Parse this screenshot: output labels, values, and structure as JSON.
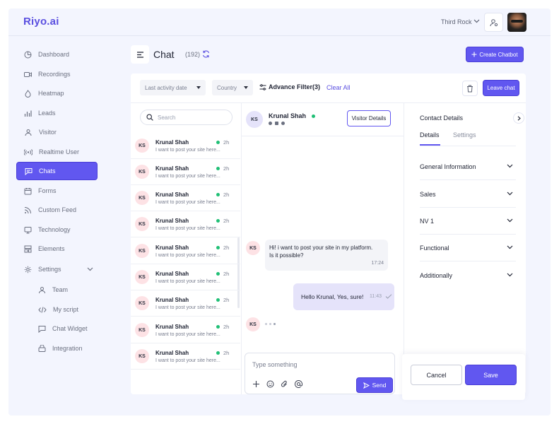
{
  "brand": {
    "logo": "Riyo.ai",
    "accent": "#6157f0"
  },
  "header": {
    "org": "Third Rock"
  },
  "sidebar": {
    "items": [
      {
        "label": "Dashboard",
        "icon": "dashboard-icon"
      },
      {
        "label": "Recordings",
        "icon": "video-icon"
      },
      {
        "label": "Heatmap",
        "icon": "heatmap-icon"
      },
      {
        "label": "Leads",
        "icon": "bar-chart-icon"
      },
      {
        "label": "Visitor",
        "icon": "users-icon"
      },
      {
        "label": "Realtime User",
        "icon": "broadcast-icon"
      },
      {
        "label": "Chats",
        "icon": "chat-icon",
        "active": true
      },
      {
        "label": "Forms",
        "icon": "calendar-icon"
      },
      {
        "label": "Custom Feed",
        "icon": "rss-icon"
      },
      {
        "label": "Technology",
        "icon": "monitor-icon"
      },
      {
        "label": "Elements",
        "icon": "layout-icon"
      },
      {
        "label": "Settings",
        "icon": "gear-icon"
      }
    ],
    "sub_items": [
      {
        "label": "Team",
        "icon": "team-icon"
      },
      {
        "label": "My script",
        "icon": "code-icon"
      },
      {
        "label": "Chat Widget",
        "icon": "widget-icon"
      },
      {
        "label": "Integration",
        "icon": "plug-icon"
      }
    ]
  },
  "page": {
    "title": "Chat",
    "count": "(192)",
    "create_label": "Create Chatbot"
  },
  "filters": {
    "activity": "Last activity date",
    "country": "Country",
    "advance": "Advance Filter(3)",
    "clear": "Clear All",
    "leave": "Leave chat"
  },
  "chat_list": {
    "search_placeholder": "Search",
    "rows": [
      {
        "initials": "KS",
        "name": "Krunal Shah",
        "message": "I want to post your site here...",
        "time": "2h"
      },
      {
        "initials": "KS",
        "name": "Krunal Shah",
        "message": "I want to post your site here...",
        "time": "2h"
      },
      {
        "initials": "KS",
        "name": "Krunal Shah",
        "message": "I want to post your site here...",
        "time": "2h"
      },
      {
        "initials": "KS",
        "name": "Krunal Shah",
        "message": "I want to post your site here...",
        "time": "2h"
      },
      {
        "initials": "KS",
        "name": "Krunal Shah",
        "message": "I want to post your site here...",
        "time": "2h"
      },
      {
        "initials": "KS",
        "name": "Krunal Shah",
        "message": "I want to post your site here...",
        "time": "2h"
      },
      {
        "initials": "KS",
        "name": "Krunal Shah",
        "message": "I want to post your site here...",
        "time": "2h"
      },
      {
        "initials": "KS",
        "name": "Krunal Shah",
        "message": "I want to post your site here...",
        "time": "2h"
      },
      {
        "initials": "KS",
        "name": "Krunal Shah",
        "message": "I want to post your site here...",
        "time": "2h"
      }
    ]
  },
  "conversation": {
    "initials": "KS",
    "name": "Krunal Shah",
    "visitor_details": "Visitor Details",
    "incoming_line1": "Hi! i want  to post your site in my platform.",
    "incoming_line2": "Is it possible?",
    "incoming_time": "17:24",
    "outgoing": "Hello Krunal, Yes, sure!",
    "outgoing_time": "11:43",
    "composer_placeholder": "Type something",
    "send": "Send"
  },
  "details": {
    "title": "Contact Details",
    "tabs": [
      "Details",
      "Settings"
    ],
    "sections": [
      "General Information",
      "Sales",
      "NV 1",
      "Functional",
      "Additionally"
    ],
    "cancel": "Cancel",
    "save": "Save"
  }
}
